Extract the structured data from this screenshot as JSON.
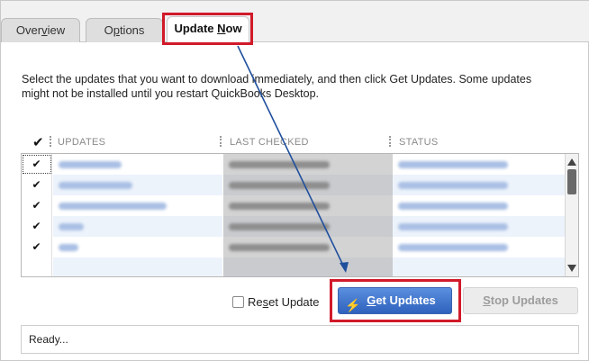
{
  "tabs": [
    {
      "label_pre": "Over",
      "label_u": "v",
      "label_post": "iew"
    },
    {
      "label_pre": "O",
      "label_u": "p",
      "label_post": "tions"
    },
    {
      "label_pre": "Update ",
      "label_u": "N",
      "label_post": "ow"
    }
  ],
  "instructions": "Select the updates that you want to download immediately, and then click Get Updates. Some updates might not be installed until you restart QuickBooks Desktop.",
  "table": {
    "check_header": "✔",
    "columns": [
      "UPDATES",
      "LAST CHECKED",
      "STATUS"
    ],
    "rows": [
      {
        "checked": "✔"
      },
      {
        "checked": "✔"
      },
      {
        "checked": "✔"
      },
      {
        "checked": "✔"
      },
      {
        "checked": "✔"
      },
      {
        "checked": ""
      }
    ]
  },
  "reset_update": {
    "pre": "Re",
    "u": "s",
    "post": "et Update"
  },
  "get_updates": {
    "pre": "",
    "u": "G",
    "post": "et Updates"
  },
  "stop_updates": {
    "pre": "",
    "u": "S",
    "post": "top Updates"
  },
  "status_text": "Ready...",
  "colors": {
    "highlight": "#d11a2a",
    "primary_button": "#2e62bd",
    "arrow": "#1f4f9c"
  }
}
